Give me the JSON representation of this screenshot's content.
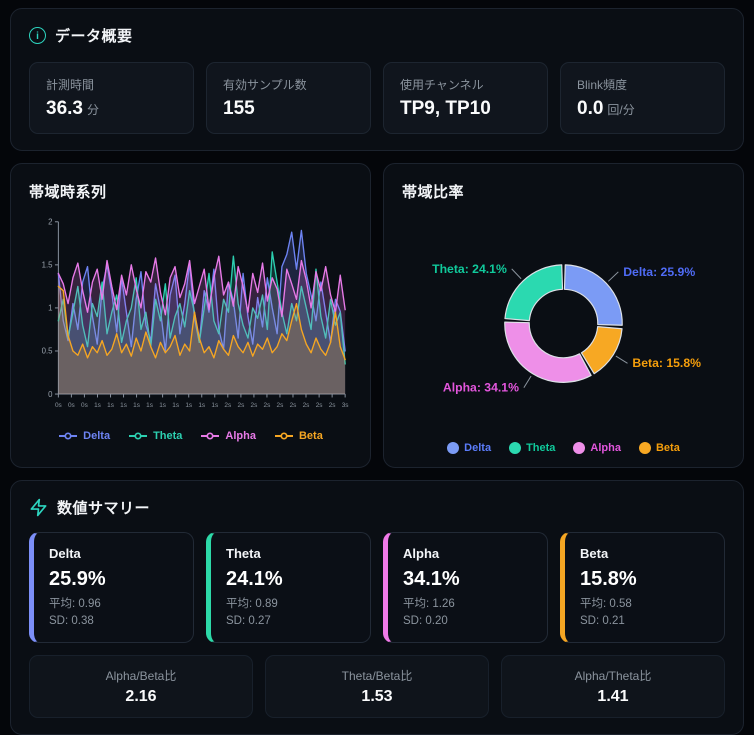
{
  "accent": "#2dd4bf",
  "overview": {
    "title": "データ概要",
    "stats": [
      {
        "label": "計測時間",
        "value": "36.3",
        "unit": "分"
      },
      {
        "label": "有効サンプル数",
        "value": "155",
        "unit": ""
      },
      {
        "label": "使用チャンネル",
        "value": "TP9, TP10",
        "unit": ""
      },
      {
        "label": "Blink頻度",
        "value": "0.0",
        "unit": "回/分"
      }
    ]
  },
  "timeseries_panel": {
    "title": "帯域時系列"
  },
  "ratio_panel": {
    "title": "帯域比率"
  },
  "summary": {
    "title": "数値サマリー",
    "bands": [
      {
        "name": "Delta",
        "pct": "25.9%",
        "mean_text": "平均: 0.96",
        "sd_text": "SD: 0.38",
        "color": "#7c8ff8"
      },
      {
        "name": "Theta",
        "pct": "24.1%",
        "mean_text": "平均: 0.89",
        "sd_text": "SD: 0.27",
        "color": "#2dd9a8"
      },
      {
        "name": "Alpha",
        "pct": "34.1%",
        "mean_text": "平均: 1.26",
        "sd_text": "SD: 0.20",
        "color": "#f07ae8"
      },
      {
        "name": "Beta",
        "pct": "15.8%",
        "mean_text": "平均: 0.58",
        "sd_text": "SD: 0.21",
        "color": "#f5a623"
      }
    ],
    "ratios": [
      {
        "label": "Alpha/Beta比",
        "value": "2.16"
      },
      {
        "label": "Theta/Beta比",
        "value": "1.53"
      },
      {
        "label": "Alpha/Theta比",
        "value": "1.41"
      }
    ]
  },
  "chart_data": [
    {
      "type": "line",
      "title": "帯域時系列",
      "xlabel": "",
      "ylabel": "",
      "ylim": [
        0,
        2
      ],
      "yticks": [
        0,
        0.5,
        1,
        1.5,
        2
      ],
      "grid": false,
      "legend_position": "bottom",
      "x_tick_labels": [
        "0s",
        "0s",
        "0s",
        "1s",
        "1s",
        "1s",
        "1s",
        "1s",
        "1s",
        "1s",
        "1s",
        "1s",
        "1s",
        "2s",
        "2s",
        "2s",
        "2s",
        "2s",
        "2s",
        "2s",
        "2s",
        "2s",
        "3s"
      ],
      "series": [
        {
          "name": "Delta",
          "color": "#6d83f2",
          "values": [
            1.4,
            0.85,
            0.62,
            1.05,
            0.75,
            1.3,
            1.48,
            0.9,
            0.58,
            1.22,
            1.5,
            1.18,
            0.72,
            1.35,
            0.95,
            0.55,
            1.1,
            1.42,
            0.8,
            0.62,
            1.28,
            0.98,
            0.5,
            1.15,
            1.38,
            0.7,
            1.05,
            1.52,
            0.88,
            0.6,
            1.2,
            0.95,
            1.45,
            0.75,
            0.52,
            1.3,
            1.08,
            0.65,
            1.4,
            0.9,
            0.58,
            1.12,
            0.78,
            1.35,
            1.0,
            0.7,
            1.48,
            1.62,
            1.88,
            1.45,
            1.9,
            1.4,
            1.15,
            0.85,
            1.3,
            0.95,
            0.6,
            1.1,
            0.96,
            0.5
          ]
        },
        {
          "name": "Theta",
          "color": "#2ccfb0",
          "values": [
            0.85,
            1.1,
            0.65,
            0.95,
            1.25,
            0.8,
            0.55,
            1.05,
            0.9,
            1.3,
            0.7,
            0.95,
            1.15,
            0.6,
            0.85,
            1.0,
            1.35,
            0.75,
            0.95,
            0.55,
            1.1,
            0.85,
            1.28,
            0.65,
            0.9,
            1.05,
            0.78,
            1.2,
            0.95,
            0.6,
            1.0,
            1.4,
            0.85,
            0.7,
            1.1,
            0.95,
            1.6,
            1.05,
            0.8,
            0.65,
            1.0,
            0.88,
            1.15,
            0.75,
            1.65,
            1.3,
            0.95,
            0.7,
            1.05,
            0.85,
            1.25,
            1.0,
            0.75,
            1.45,
            0.9,
            0.65,
            1.1,
            0.8,
            0.95,
            0.35
          ]
        },
        {
          "name": "Alpha",
          "color": "#e87ae8",
          "values": [
            1.4,
            1.28,
            1.05,
            1.35,
            1.52,
            1.2,
            0.95,
            1.3,
            1.45,
            1.1,
            1.55,
            1.25,
            0.98,
            1.38,
            1.15,
            1.5,
            1.22,
            1.0,
            1.42,
            1.3,
            1.58,
            1.18,
            0.92,
            1.35,
            1.48,
            1.12,
            1.28,
            1.55,
            1.05,
            1.25,
            1.45,
            0.98,
            1.35,
            1.6,
            1.15,
            1.3,
            1.02,
            1.48,
            1.25,
            0.95,
            1.4,
            1.18,
            1.52,
            1.08,
            1.35,
            1.22,
            0.9,
            1.45,
            1.28,
            1.1,
            1.55,
            1.32,
            1.0,
            1.42,
            1.2,
            1.48,
            1.15,
            0.95,
            1.38,
            0.98
          ]
        },
        {
          "name": "Beta",
          "color": "#f5a623",
          "values": [
            1.25,
            1.2,
            0.68,
            0.5,
            0.45,
            0.58,
            0.42,
            0.55,
            0.48,
            0.62,
            0.45,
            0.52,
            0.7,
            0.48,
            0.58,
            0.44,
            0.65,
            0.5,
            0.72,
            0.55,
            0.42,
            0.6,
            0.48,
            0.55,
            0.68,
            0.45,
            0.58,
            0.5,
            0.95,
            0.65,
            0.48,
            0.55,
            0.42,
            0.62,
            0.52,
            0.45,
            0.68,
            0.55,
            0.48,
            0.6,
            0.44,
            0.58,
            0.52,
            0.65,
            0.48,
            0.55,
            0.7,
            0.62,
            0.85,
            1.05,
            0.75,
            0.58,
            0.48,
            0.65,
            0.52,
            0.45,
            0.6,
            0.95,
            0.55,
            0.4
          ]
        }
      ]
    },
    {
      "type": "pie",
      "title": "帯域比率",
      "donut": true,
      "start_angle": "top",
      "clockwise": true,
      "segments": [
        {
          "name": "Delta",
          "value": 25.9,
          "label": "Delta: 25.9%",
          "color": "#7b9bf5",
          "label_color": "#4f6bf5"
        },
        {
          "name": "Beta",
          "value": 15.8,
          "label": "Beta: 15.8%",
          "color": "#f7a823",
          "label_color": "#f59e0b"
        },
        {
          "name": "Alpha",
          "value": 34.1,
          "label": "Alpha: 34.1%",
          "color": "#ee8fe8",
          "label_color": "#e356dd"
        },
        {
          "name": "Theta",
          "value": 24.1,
          "label": "Theta: 24.1%",
          "color": "#2bd9b0",
          "label_color": "#10c99b"
        }
      ],
      "legend": [
        {
          "name": "Delta",
          "color": "#7b9bf5",
          "text_color": "#5b7cfa"
        },
        {
          "name": "Theta",
          "color": "#2bd9b0",
          "text_color": "#10c99b"
        },
        {
          "name": "Alpha",
          "color": "#ee8fe8",
          "text_color": "#e356dd"
        },
        {
          "name": "Beta",
          "color": "#f7a823",
          "text_color": "#f59e0b"
        }
      ],
      "legend_position": "bottom"
    }
  ]
}
